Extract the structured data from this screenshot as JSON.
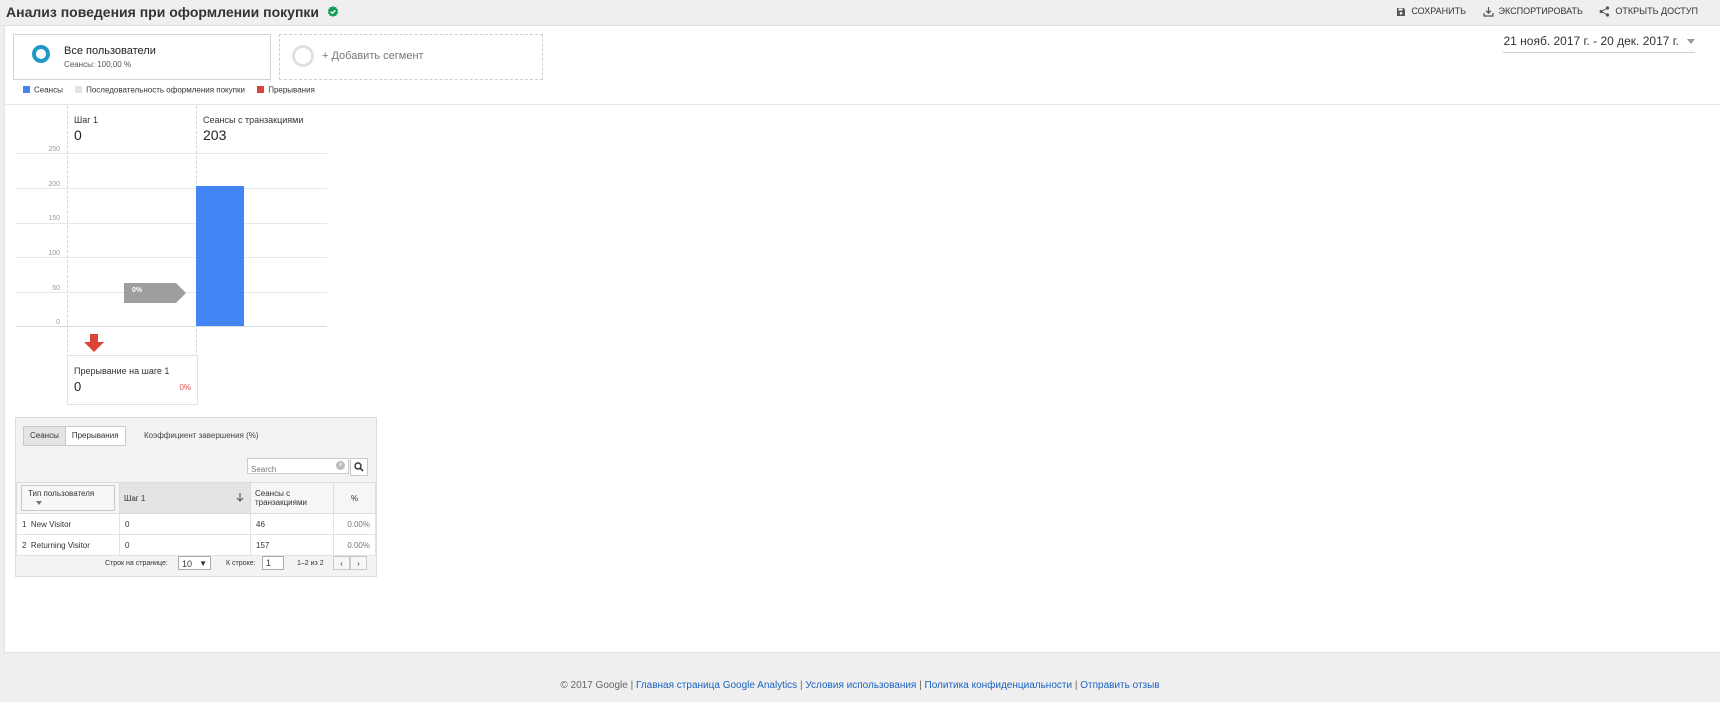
{
  "header": {
    "title": "Анализ поведения при оформлении покупки",
    "actions": {
      "save": "СОХРАНИТЬ",
      "export": "ЭКСПОРТИРОВАТЬ",
      "share": "ОТКРЫТЬ ДОСТУП"
    }
  },
  "segments": {
    "active": {
      "name": "Все пользователи",
      "sub": "Сеансы: 100,00 %"
    },
    "add": "+ Добавить сегмент"
  },
  "date_range": "21 нояб. 2017 г. - 20 дек. 2017 г.",
  "legend": [
    {
      "label": "Сеансы",
      "color": "#4285f4"
    },
    {
      "label": "Последовательность оформления покупки",
      "color": "#e3e3e3"
    },
    {
      "label": "Прерывания",
      "color": "#db4437"
    }
  ],
  "funnel": {
    "steps": [
      {
        "name": "Шаг 1",
        "value": "0"
      },
      {
        "name": "Сеансы с транзакциями",
        "value": "203"
      }
    ],
    "y_ticks": [
      "250",
      "200",
      "150",
      "100",
      "50",
      "0"
    ],
    "conversion_label": "0%",
    "dropoff": {
      "title": "Прерывание на шаге 1",
      "value": "0",
      "percent": "0%"
    }
  },
  "chart_data": {
    "type": "bar",
    "categories": [
      "Шаг 1",
      "Сеансы с транзакциями"
    ],
    "values": [
      0,
      203
    ],
    "ylim": [
      0,
      250
    ],
    "yticks": [
      0,
      50,
      100,
      150,
      200,
      250
    ],
    "color": "#4285f4"
  },
  "table": {
    "tabs": [
      "Сеансы",
      "Прерывания"
    ],
    "rate_label": "Коэффициент завершения (%)",
    "search_placeholder": "Search",
    "dimension": "Тип пользователя",
    "columns": [
      "Шаг 1",
      "Сеансы с транзакциями",
      "%"
    ],
    "rows": [
      {
        "idx": "1",
        "name": "New Visitor",
        "step1": "0",
        "trans": "46",
        "pct": "0.00%"
      },
      {
        "idx": "2",
        "name": "Returning Visitor",
        "step1": "0",
        "trans": "157",
        "pct": "0.00%"
      }
    ],
    "pager": {
      "rows_label": "Строк на странице:",
      "rows_value": "10",
      "goto_label": "К строке:",
      "goto_value": "1",
      "range": "1–2 из 2"
    }
  },
  "footer": {
    "copyright": "© 2017 Google",
    "links": [
      "Главная страница Google Analytics",
      "Условия использования",
      "Политика конфиденциальности",
      "Отправить отзыв"
    ]
  }
}
